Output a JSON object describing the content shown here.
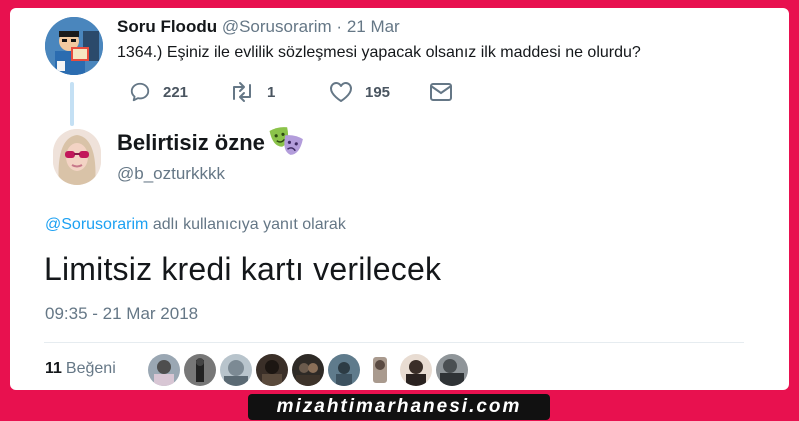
{
  "original_tweet": {
    "name": "Soru Floodu",
    "handle": "@Sorusorarim",
    "separator": "·",
    "date": "21 Mar",
    "text": "1364.) Eşiniz ile evlilik sözleşmesi yapacak olsanız ilk maddesi ne olurdu?",
    "actions": {
      "reply_count": "221",
      "retweet_count": "1",
      "like_count": "195"
    },
    "icons": [
      "reply-icon",
      "retweet-icon",
      "heart-icon",
      "mail-icon"
    ]
  },
  "reply": {
    "name": "Belirtisiz özne",
    "name_emoji": "performing-arts-masks",
    "handle": "@b_ozturkkkk",
    "reply_to_mention": "@Sorusorarim",
    "reply_to_text": " adlı kullanıcıya yanıt olarak",
    "text": "Limitsiz kredi kartı verilecek",
    "timestamp": "09:35 - 21 Mar 2018",
    "likes_count": "11",
    "likes_label": "Beğeni",
    "likers_shown": 9
  },
  "watermark": "mizahtimarhanesi.com",
  "colors": {
    "frame": "#e8114f",
    "mention": "#1da1f2",
    "muted": "#657786",
    "thread_line": "#c4e0f4"
  }
}
